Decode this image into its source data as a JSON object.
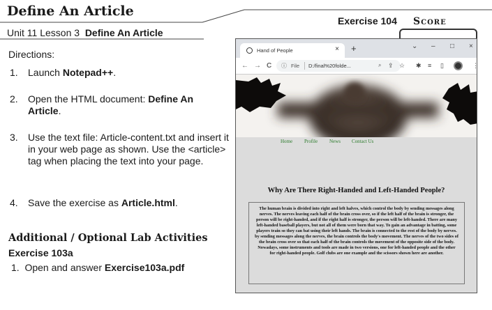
{
  "header": {
    "title": "Define An Article",
    "subtitle_prefix": "Unit 11 Lesson 3",
    "subtitle_bold": "Define An Article",
    "exercise": "Exercise 104",
    "score": "Score"
  },
  "directions": {
    "label": "Directions:",
    "steps": [
      {
        "num": "1.",
        "pre": "Launch ",
        "bold": "Notepad++",
        "post": "."
      },
      {
        "num": "2.",
        "pre": "Open the HTML document: ",
        "bold": "Define An Article",
        "post": "."
      },
      {
        "num": "3.",
        "pre": "Use the text file: Article-content.txt and insert it in your web page as shown. Use the <article> tag when placing the text into your page.",
        "bold": "",
        "post": ""
      },
      {
        "num": "4.",
        "pre": "Save the exercise as ",
        "bold": "Article.html",
        "post": "."
      }
    ]
  },
  "additional": {
    "title": "Additional / Optional Lab Activities",
    "exercise": "Exercise 103a",
    "step_num": "1.",
    "step_pre": "Open and answer ",
    "step_bold": "Exercise103a.pdf"
  },
  "browser": {
    "tab_title": "Hand of People",
    "tab_close": "×",
    "new_tab": "+",
    "win_chevron": "⌄",
    "win_min": "–",
    "win_max": "□",
    "win_close": "×",
    "back": "←",
    "forward": "→",
    "reload": "C",
    "info": "ⓘ",
    "file_label": "File",
    "address": "D:/final%20folde...",
    "zoom": "🔍",
    "icons": [
      "share-icon",
      "star-icon",
      "extensions-icon",
      "reading-list-icon",
      "sidebar-icon",
      "profile-icon",
      "menu-icon"
    ]
  },
  "web_page": {
    "menu": [
      "Home",
      "Profile",
      "News",
      "Contact Us"
    ],
    "article_title": "Why Are There Right-Handed and Left-Handed People?",
    "article_body": "The human brain is divided into right and left halves, which control the body by sending messages along nerves. The nerves leaving each half of the brain cross over, so if the left half of the brain is stronger, the person will be right-handed, and if the right half is stronger, the person will be left-handed. There are many left-handed baseball players, but not all of them were born that way. To gain an advantage in batting, some players train so they can bat using their left hands. The brain is connected to the rest of the body by nerves. by sending messages along the nerves, the brain controls the body's movement. The nerves of the two sides of the brain cross over so that each half of the brain controls the movement of the opposite side of the body. Nowadays, some instruments and tools are made in two versions, one for left-handed people and the other for right-handed people. Golf clubs are one example and the scissors shown here are another."
  },
  "colors": {
    "menu_link": "#2a7a2a",
    "page_bg": "#dcdcdc",
    "tab_bar": "#dee1e6"
  }
}
